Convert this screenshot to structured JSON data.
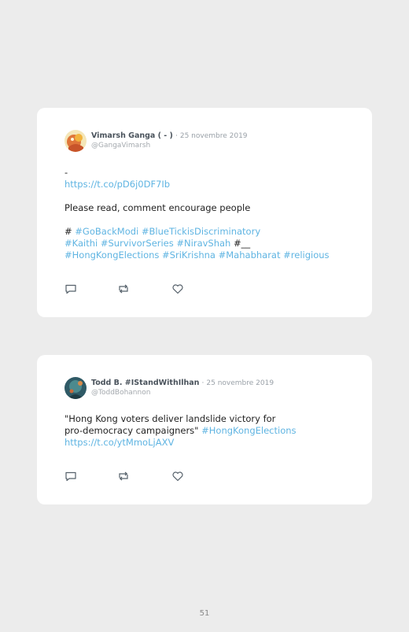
{
  "tweets": [
    {
      "name": "Vimarsh Ganga ( - )",
      "separator": "·",
      "date": "25 novembre 2019",
      "handle": "@GangaVimarsh",
      "line1": "-",
      "link": "https://t.co/pD6j0DF7Ib",
      "line2": "Please read, comment encourage people",
      "line3_prefix": "#",
      "line3_tags": "#GoBackModi #BlueTickisDiscriminatory",
      "line4_tags": "#Kaithi #SurvivorSeries #NiravShah",
      "line4_suffix": "#__",
      "line5_tags": "#HongKongElections #SriKrishna #Mahabharat #religious"
    },
    {
      "name": "Todd B. #IStandWithIlhan",
      "separator": "·",
      "date": "25 novembre 2019",
      "handle": "@ToddBohannon",
      "line1": "\"Hong Kong voters deliver landslide victory for",
      "line2_text": "pro-democracy campaigners\"",
      "line2_tag": "#HongKongElections",
      "link": "https://t.co/ytMmoLjAXV"
    }
  ],
  "icons": [
    "reply-icon",
    "retweet-icon",
    "like-icon"
  ],
  "colors": {
    "link": "#5fb4e2",
    "background": "#ececec",
    "card": "#ffffff"
  },
  "page_number": "51"
}
